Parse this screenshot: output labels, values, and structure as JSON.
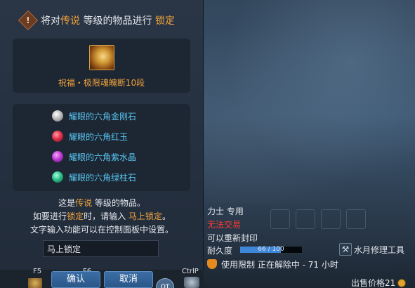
{
  "dialog": {
    "title_prefix": "将对",
    "title_grade": "传说",
    "title_middle": "等级的物品进行",
    "title_action": "锁定",
    "item_name": "祝福・极限魂魄断10段",
    "materials": [
      {
        "label": "耀眼的六角金刚石",
        "color": "#d9d9d9"
      },
      {
        "label": "耀眼的六角红玉",
        "color": "#e0324a"
      },
      {
        "label": "耀眼的六角紫水晶",
        "color": "#c23bd6"
      },
      {
        "label": "耀眼的六角绿柱石",
        "color": "#2fbf8a"
      }
    ],
    "desc1_prefix": "这是",
    "desc1_grade": "传说",
    "desc1_suffix": "等级的物品。",
    "desc2_prefix": "如要进行",
    "desc2_hl1": "锁定",
    "desc2_mid": "时，请输入",
    "desc2_hl2": "马上锁定",
    "desc2_suffix": "。",
    "desc3": "文字输入功能可以在控制面板中设置。",
    "input_value": "马上锁定",
    "confirm_label": "确认",
    "cancel_label": "取消"
  },
  "shortcut_bar": {
    "key_f5": "F5",
    "key_f6": "F6",
    "key_ctrlp": "CtrlP",
    "round_btn_label": "QT"
  },
  "tooltip": {
    "class_req": "力士 专用",
    "trade": "无法交易",
    "reseal": "可以重新封印",
    "durability_label": "耐久度",
    "durability_text": "66 / 100",
    "durability_ratio": 0.66,
    "repair_tool": "水月修理工具",
    "restriction": "使用限制 正在解除中 - 71 小时",
    "price": "出售价格21"
  },
  "colors": {
    "accent_orange": "#f0a23b",
    "gem_text_blue": "#58c7f2",
    "warning_red": "#ff3b2f",
    "button_blue": "#2b5688"
  }
}
